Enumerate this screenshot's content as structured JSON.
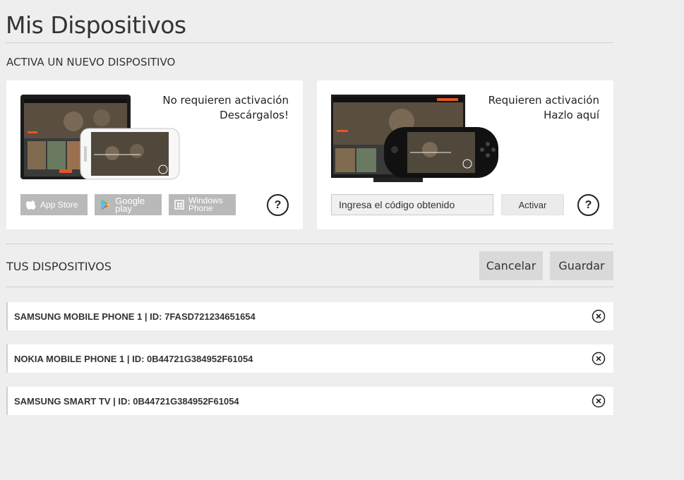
{
  "header": {
    "title": "Mis Dispositivos"
  },
  "activate_section": {
    "title": "ACTIVA UN NUEVO DISPOSITIVO",
    "no_activation_card": {
      "heading_line1": "No requieren activación",
      "heading_line2": "Descárgalos!",
      "stores": [
        {
          "label": "App Store",
          "icon": "apple-icon"
        },
        {
          "label": "Google play",
          "icon": "google-play-icon"
        },
        {
          "label_line1": "Windows",
          "label_line2": "Phone",
          "icon": "windows-icon"
        }
      ],
      "help_label": "?"
    },
    "activation_card": {
      "heading_line1": "Requieren activación",
      "heading_line2": "Hazlo aquí",
      "code_placeholder": "Ingresa el código obtenido",
      "activate_label": "Activar",
      "help_label": "?"
    }
  },
  "devices_section": {
    "title": "TUS DISPOSITIVOS",
    "cancel_label": "Cancelar",
    "save_label": "Guardar",
    "devices": [
      {
        "label": "SAMSUNG MOBILE PHONE 1 | ID: 7FASD721234651654"
      },
      {
        "label": "NOKIA MOBILE PHONE 1 | ID: 0B44721G384952F61054"
      },
      {
        "label": "SAMSUNG SMART TV | ID: 0B44721G384952F61054"
      }
    ]
  },
  "colors": {
    "background": "#eeeeee",
    "card": "#ffffff",
    "button": "#d9d9d9",
    "store_button": "#b9b9b9"
  }
}
